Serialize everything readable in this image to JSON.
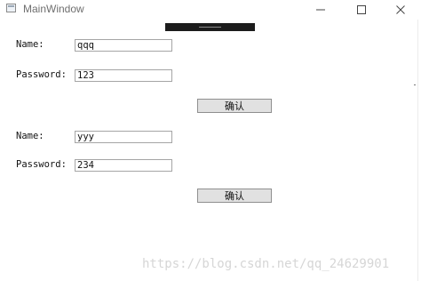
{
  "window": {
    "title": "MainWindow",
    "icons": {
      "app": "window-app-icon",
      "minimize": "minimize-icon",
      "maximize": "maximize-icon",
      "close": "close-icon"
    }
  },
  "forms": [
    {
      "name_label": "Name:",
      "name_value": "qqq",
      "password_label": "Password:",
      "password_value": "123",
      "confirm_label": "确认"
    },
    {
      "name_label": "Name:",
      "name_value": "yyy",
      "password_label": "Password:",
      "password_value": "234",
      "confirm_label": "确认"
    }
  ],
  "watermark": "https://blog.csdn.net/qq_24629901",
  "colors": {
    "titlebar": "#ffffff",
    "button_face": "#e1e1e1",
    "textbox_border": "#a5a5a5",
    "dragbar": "#1c1c1c"
  }
}
